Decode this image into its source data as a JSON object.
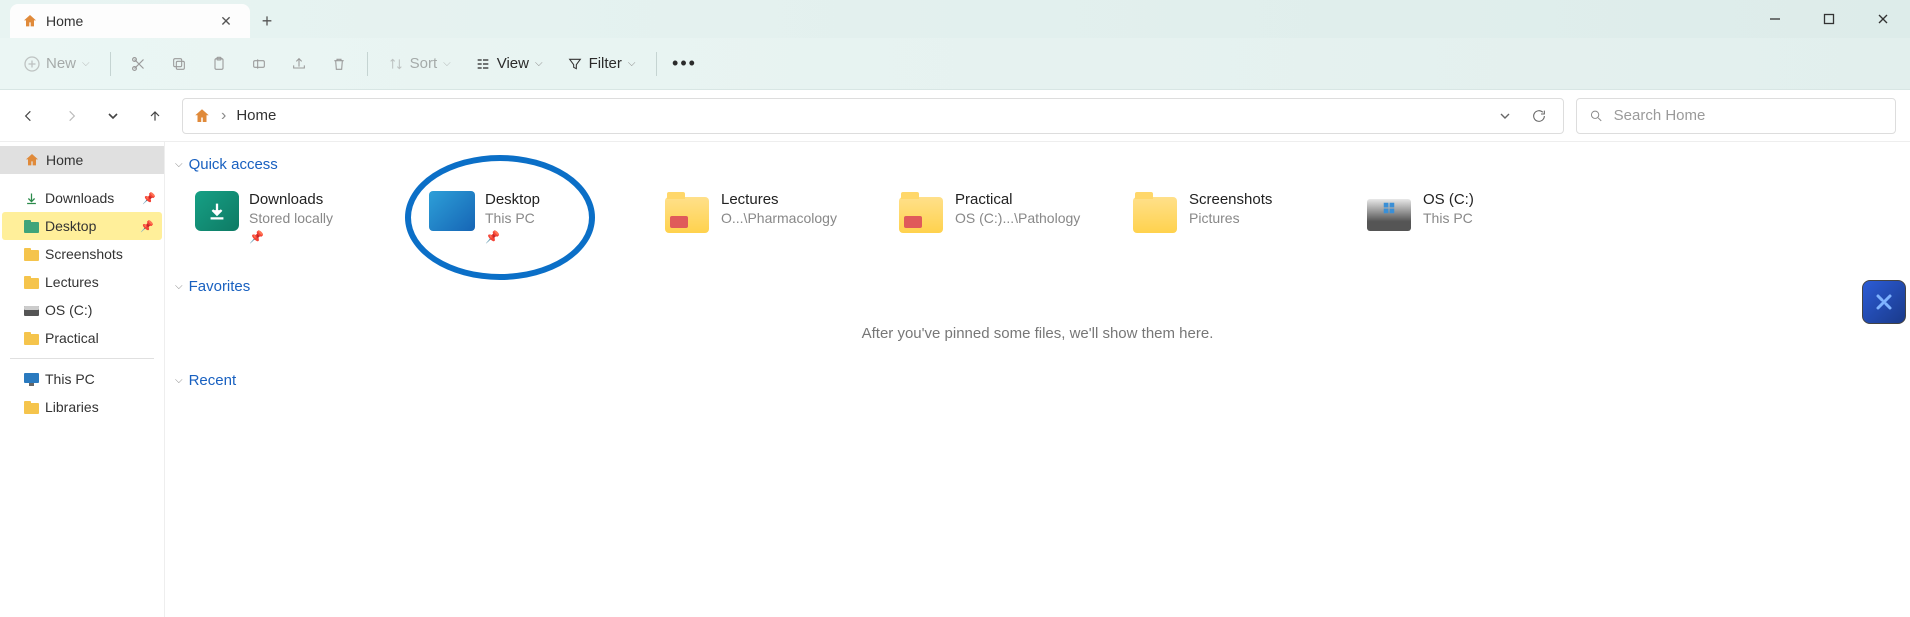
{
  "tab": {
    "title": "Home"
  },
  "toolbar": {
    "new": "New",
    "sort": "Sort",
    "view": "View",
    "filter": "Filter"
  },
  "breadcrumb": {
    "location": "Home"
  },
  "search": {
    "placeholder": "Search Home"
  },
  "sidebar": {
    "home": "Home",
    "items": [
      {
        "label": "Downloads",
        "icon": "download",
        "pinned": true
      },
      {
        "label": "Desktop",
        "icon": "folder-teal",
        "pinned": true,
        "highlighted": true
      },
      {
        "label": "Screenshots",
        "icon": "folder",
        "pinned": false
      },
      {
        "label": "Lectures",
        "icon": "folder",
        "pinned": false
      },
      {
        "label": "OS (C:)",
        "icon": "drive",
        "pinned": false
      },
      {
        "label": "Practical",
        "icon": "folder",
        "pinned": false
      }
    ],
    "group2": [
      {
        "label": "This PC",
        "icon": "pc"
      },
      {
        "label": "Libraries",
        "icon": "folder"
      }
    ]
  },
  "sections": {
    "quick_access": "Quick access",
    "favorites": "Favorites",
    "recent": "Recent",
    "favorites_empty": "After you've pinned some files, we'll show them here."
  },
  "quick_access": [
    {
      "name": "Downloads",
      "sub": "Stored locally",
      "icon": "downloads",
      "pinned": true
    },
    {
      "name": "Desktop",
      "sub": "This PC",
      "icon": "desktop",
      "pinned": true,
      "circled": true
    },
    {
      "name": "Lectures",
      "sub": "O...\\Pharmacology",
      "icon": "folder-red",
      "pinned": false
    },
    {
      "name": "Practical",
      "sub": "OS (C:)...\\Pathology",
      "icon": "folder-red",
      "pinned": false
    },
    {
      "name": "Screenshots",
      "sub": "Pictures",
      "icon": "folder",
      "pinned": false
    },
    {
      "name": "OS (C:)",
      "sub": "This PC",
      "icon": "drive",
      "pinned": false
    }
  ]
}
